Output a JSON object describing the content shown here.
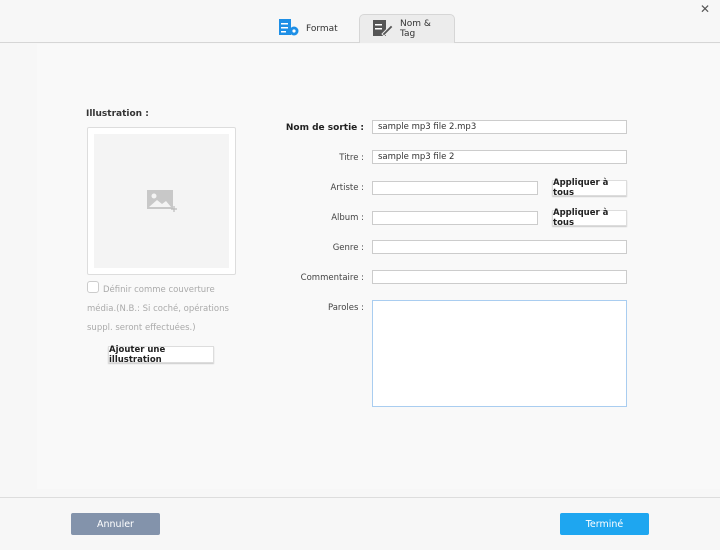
{
  "tabs": [
    {
      "label": "Format",
      "icon": "format-settings-icon"
    },
    {
      "label": "Nom & Tag",
      "icon": "edit-tag-icon"
    }
  ],
  "illustration": {
    "label": "Illustration :",
    "checkbox_label": "Définir comme couverture média.(N.B.: Si coché, opérations suppl. seront effectuées.)",
    "add_button": "Ajouter une illustration"
  },
  "fields": {
    "output_name": {
      "label": "Nom de sortie :",
      "value": "sample mp3 file 2.mp3"
    },
    "title": {
      "label": "Titre :",
      "value": "sample mp3 file 2"
    },
    "artist": {
      "label": "Artiste :",
      "value": "",
      "apply": "Appliquer à tous"
    },
    "album": {
      "label": "Album :",
      "value": "",
      "apply": "Appliquer à tous"
    },
    "genre": {
      "label": "Genre :",
      "value": ""
    },
    "comment": {
      "label": "Commentaire :",
      "value": ""
    },
    "lyrics": {
      "label": "Paroles :",
      "value": ""
    }
  },
  "footer": {
    "cancel": "Annuler",
    "done": "Terminé"
  },
  "colors": {
    "accent": "#1ea6f0",
    "cancel": "#8393ab"
  }
}
